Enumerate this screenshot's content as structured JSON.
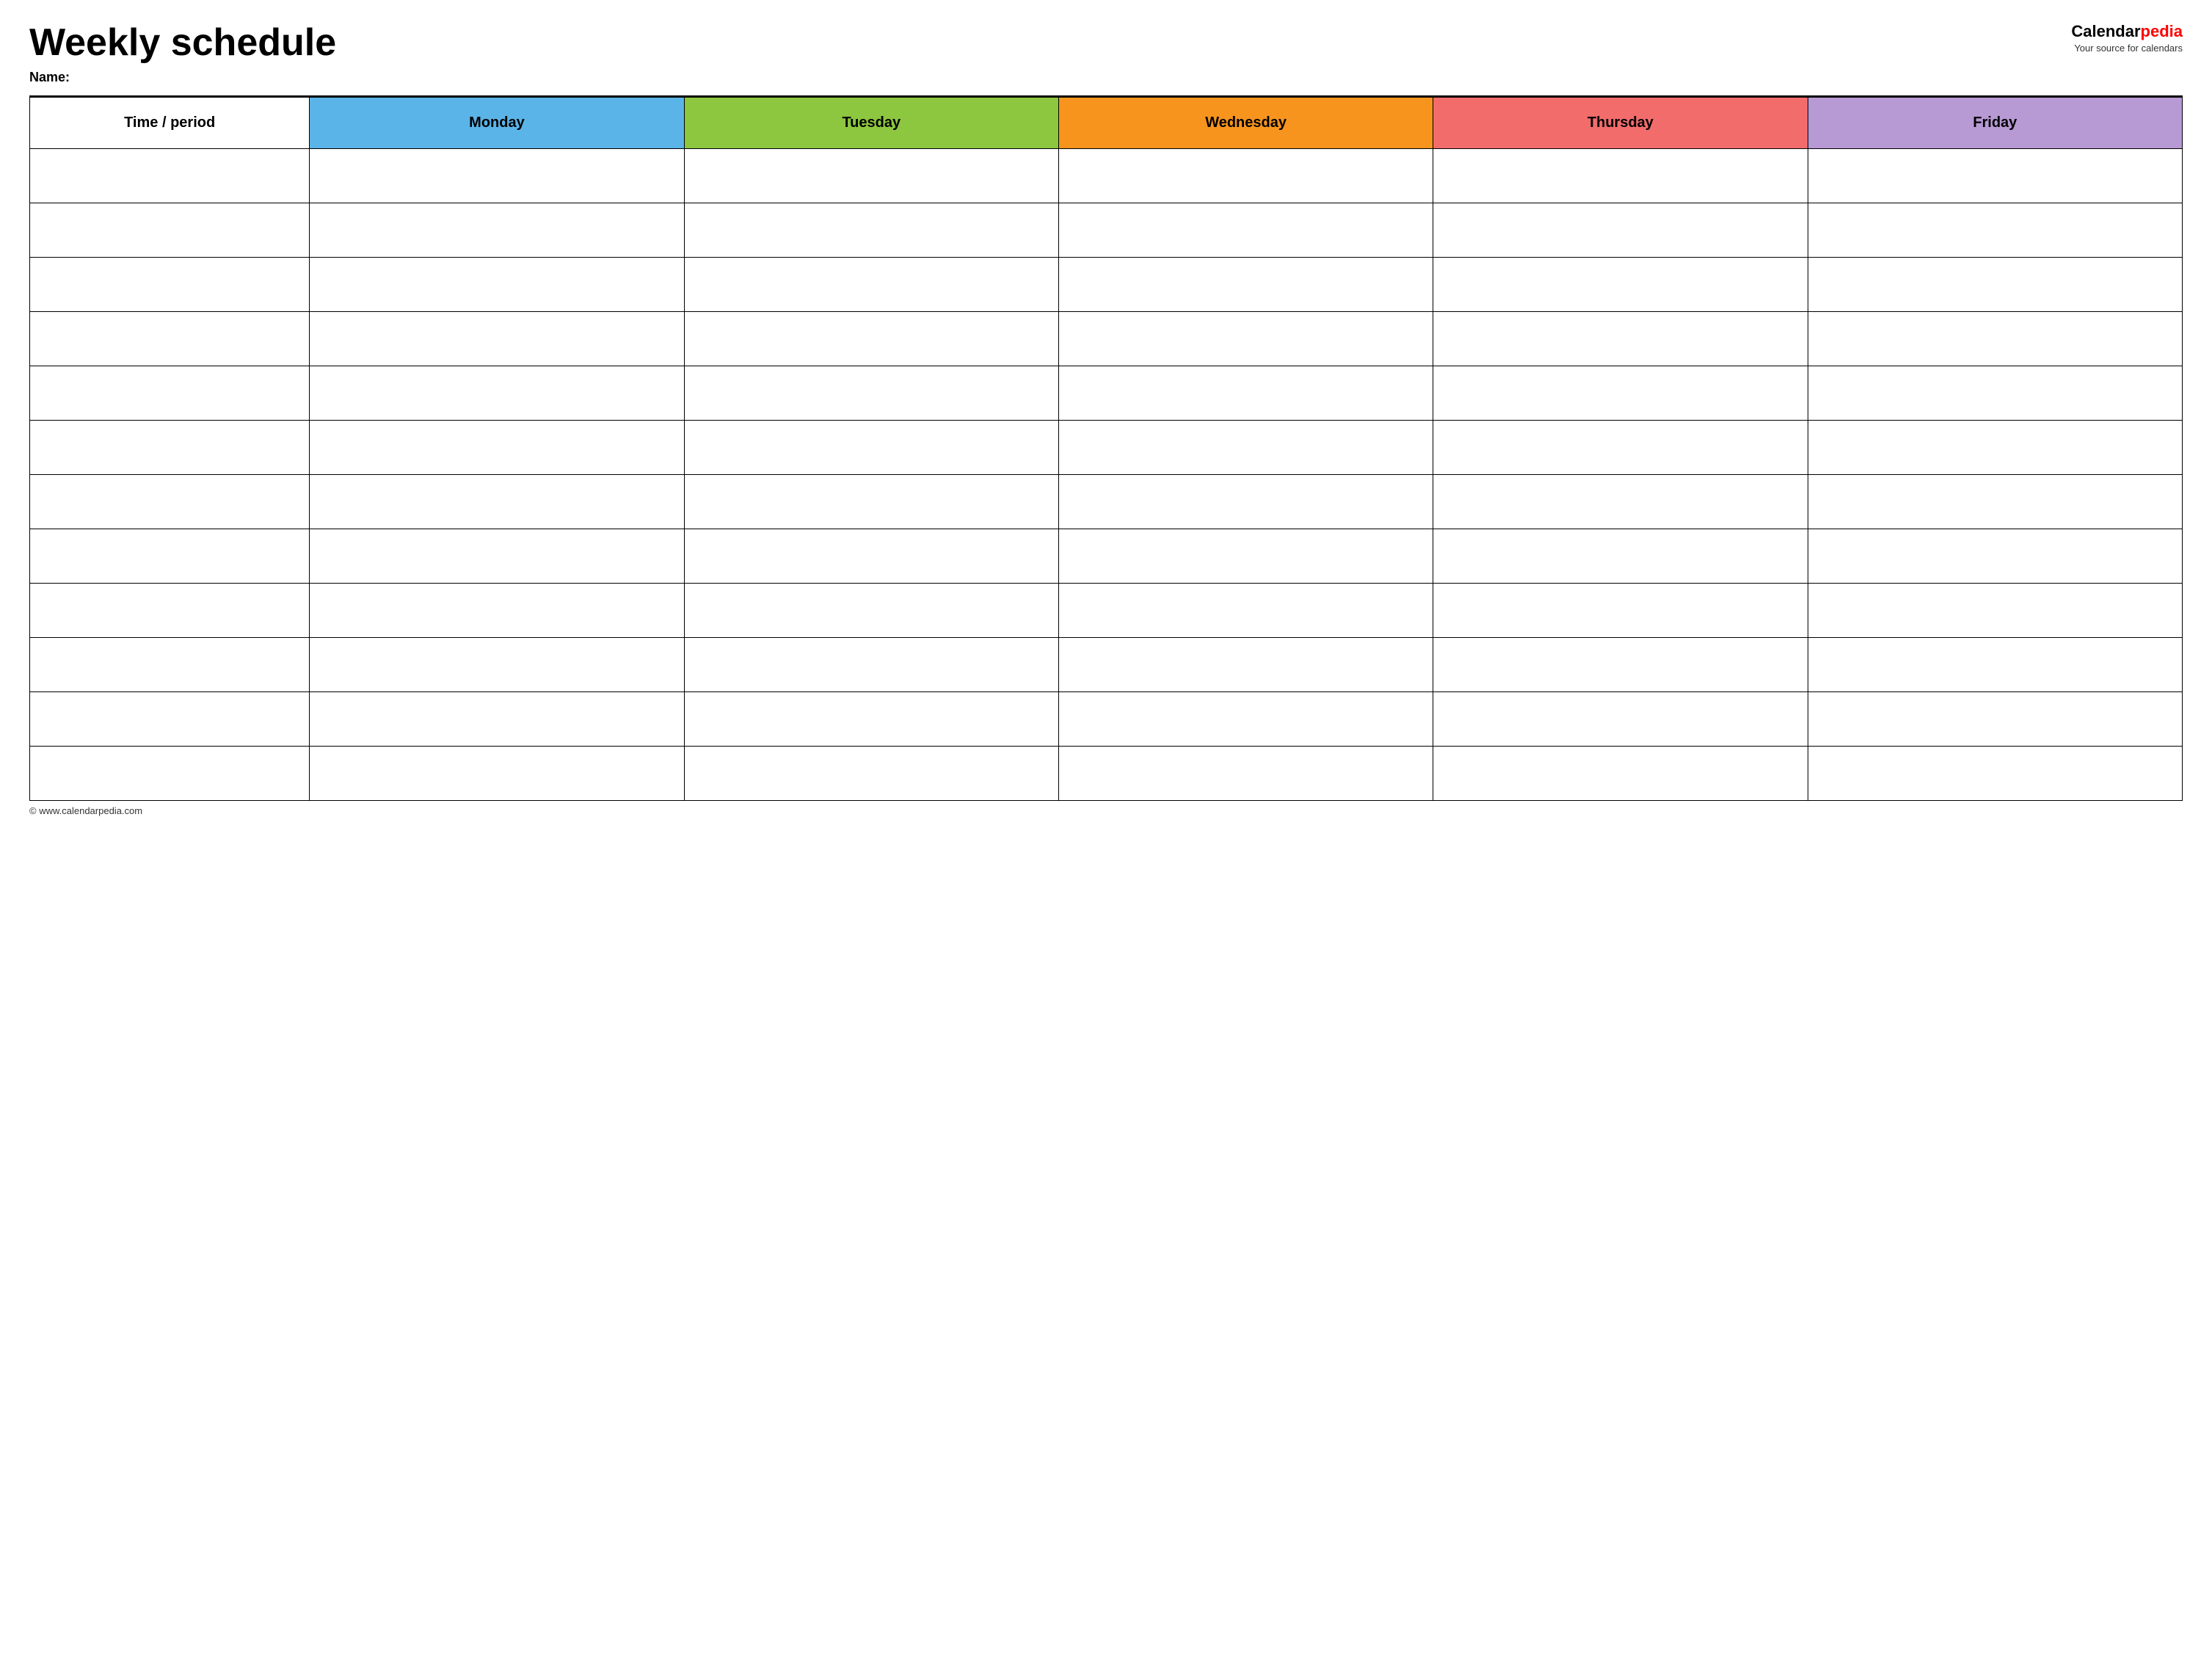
{
  "header": {
    "title": "Weekly schedule",
    "name_label": "Name:",
    "logo": {
      "calendar": "Calendar",
      "pedia": "pedia",
      "tagline": "Your source for calendars"
    }
  },
  "table": {
    "columns": [
      {
        "key": "time",
        "label": "Time / period",
        "color": "#ffffff"
      },
      {
        "key": "monday",
        "label": "Monday",
        "color": "#5ab4e8"
      },
      {
        "key": "tuesday",
        "label": "Tuesday",
        "color": "#8dc63f"
      },
      {
        "key": "wednesday",
        "label": "Wednesday",
        "color": "#f7941d"
      },
      {
        "key": "thursday",
        "label": "Thursday",
        "color": "#f26c6c"
      },
      {
        "key": "friday",
        "label": "Friday",
        "color": "#b799d4"
      }
    ],
    "rows": 12
  },
  "footer": {
    "text": "© www.calendarpedia.com"
  }
}
